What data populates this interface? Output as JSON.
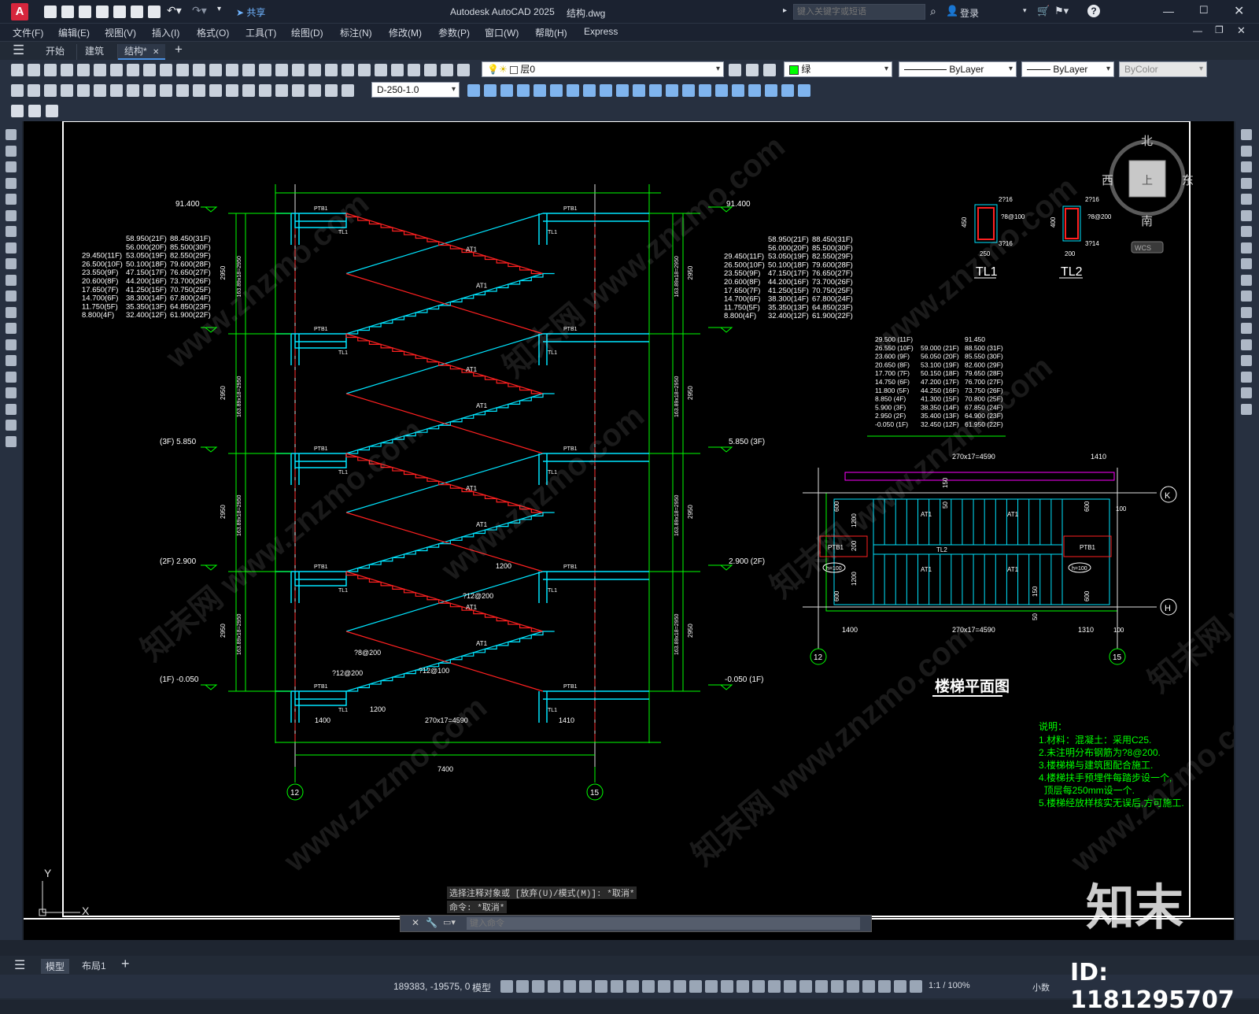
{
  "app": {
    "title": "Autodesk AutoCAD 2025",
    "filename": "结构.dwg",
    "search_placeholder": "键入关键字或短语",
    "login_label": "登录",
    "share_label": "共享"
  },
  "menu": [
    "文件(F)",
    "编辑(E)",
    "视图(V)",
    "插入(I)",
    "格式(O)",
    "工具(T)",
    "绘图(D)",
    "标注(N)",
    "修改(M)",
    "参数(P)",
    "窗口(W)",
    "帮助(H)",
    "Express"
  ],
  "tabs": [
    {
      "label": "开始"
    },
    {
      "label": "建筑"
    },
    {
      "label": "结构*"
    }
  ],
  "properties": {
    "layer": "层0",
    "color": "绿",
    "color_hex": "#00ff00",
    "linetype": "ByLayer",
    "lineweight": "ByLayer",
    "plotstyle": "ByColor",
    "dimstyle": "D-250-1.0"
  },
  "viewcube": {
    "north": "北",
    "south": "南",
    "east": "东",
    "west": "西",
    "top": "上",
    "wcs": "WCS"
  },
  "drawing": {
    "elev_top": "91.400",
    "elev_3f": "(3F) 5.850",
    "elev_3f_r": "5.850 (3F)",
    "elev_2f": "(2F) 2.900",
    "elev_2f_r": "2.900 (2F)",
    "elev_1f": "(1F) -0.050",
    "elev_1f_r": "-0.050 (1F)",
    "left_elev_table": [
      [
        "",
        "58.950(21F)",
        "88.450(31F)"
      ],
      [
        "",
        "56.000(20F)",
        "85.500(30F)"
      ],
      [
        "29.450(11F)",
        "53.050(19F)",
        "82.550(29F)"
      ],
      [
        "26.500(10F)",
        "50.100(18F)",
        "79.600(28F)"
      ],
      [
        "23.550(9F)",
        "47.150(17F)",
        "76.650(27F)"
      ],
      [
        "20.600(8F)",
        "44.200(16F)",
        "73.700(26F)"
      ],
      [
        "17.650(7F)",
        "41.250(15F)",
        "70.750(25F)"
      ],
      [
        "14.700(6F)",
        "38.300(14F)",
        "67.800(24F)"
      ],
      [
        "11.750(5F)",
        "35.350(13F)",
        "64.850(23F)"
      ],
      [
        "8.800(4F)",
        "32.400(12F)",
        "61.900(22F)"
      ]
    ],
    "plan_elev_table": [
      [
        "29.500 (11F)",
        "",
        "91.450"
      ],
      [
        "26.550 (10F)",
        "59.000 (21F)",
        "88.500 (31F)"
      ],
      [
        "23.600 (9F)",
        "56.050 (20F)",
        "85.550 (30F)"
      ],
      [
        "20.650 (8F)",
        "53.100 (19F)",
        "82.600 (29F)"
      ],
      [
        "17.700 (7F)",
        "50.150 (18F)",
        "79.650 (28F)"
      ],
      [
        "14.750 (6F)",
        "47.200 (17F)",
        "76.700 (27F)"
      ],
      [
        "11.800 (5F)",
        "44.250 (16F)",
        "73.750 (26F)"
      ],
      [
        "8.850 (4F)",
        "41.300 (15F)",
        "70.800 (25F)"
      ],
      [
        "5.900 (3F)",
        "38.350 (14F)",
        "67.850 (24F)"
      ],
      [
        "2.950 (2F)",
        "35.400 (13F)",
        "64.900 (23F)"
      ],
      [
        "-0.050 (1F)",
        "32.450 (12F)",
        "61.950 (22F)"
      ]
    ],
    "dim_story": "2950",
    "dim_steps": "163.89x18=2950",
    "dim_total": "7400",
    "dim_run": "270x17=4590",
    "dim_1400": "1400",
    "dim_1410": "1410",
    "dim_1200": "1200",
    "axis_12": "12",
    "axis_15": "15",
    "axis_k": "K",
    "axis_h": "H",
    "ptb1": "PTB1",
    "tl1": "TL1",
    "tl2": "TL2",
    "at1": "AT1",
    "rebar1": "?8@200",
    "rebar2": "?12@200",
    "rebar3": "?12@100",
    "tl1_top": "2?16",
    "tl1_side": "?8@100",
    "tl1_bot": "3?16",
    "tl1_w": "250",
    "tl1_h": "450",
    "tl2_top": "2?16",
    "tl2_side": "?8@200",
    "tl2_bot": "3?14",
    "tl2_w": "200",
    "tl2_h": "400",
    "plan_title": "楼梯平面图",
    "notes_title": "说明：",
    "notes": [
      "1.材料：混凝土：采用C25.",
      "2.未注明分布钢筋为?8@200.",
      "3.楼梯梯与建筑图配合施工.",
      "4.楼梯扶手预埋件每踏步设一个,",
      "  顶层每250mm设一个.",
      "5.楼梯经放样核实无误后,方可施工."
    ],
    "dim_1310": "1310",
    "dim_100": "100",
    "dim_600": "600",
    "dim_150": "150",
    "dim_50": "50",
    "dim_200": "200",
    "h100": "h=100"
  },
  "command": {
    "history1": "选择注释对象或 [放弃(U)/模式(M)]: *取消*",
    "history2": "命令: *取消*",
    "placeholder": "键入命令"
  },
  "layouts": [
    "模型",
    "布局1"
  ],
  "status": {
    "coords": "189383, -19575, 0",
    "model": "模型",
    "scale": "1:1 / 100%",
    "units": "小数"
  },
  "watermark": {
    "id": "ID: 1181295707",
    "brand": "知末",
    "site": "www.znzmo.com",
    "cn": "知末网"
  }
}
